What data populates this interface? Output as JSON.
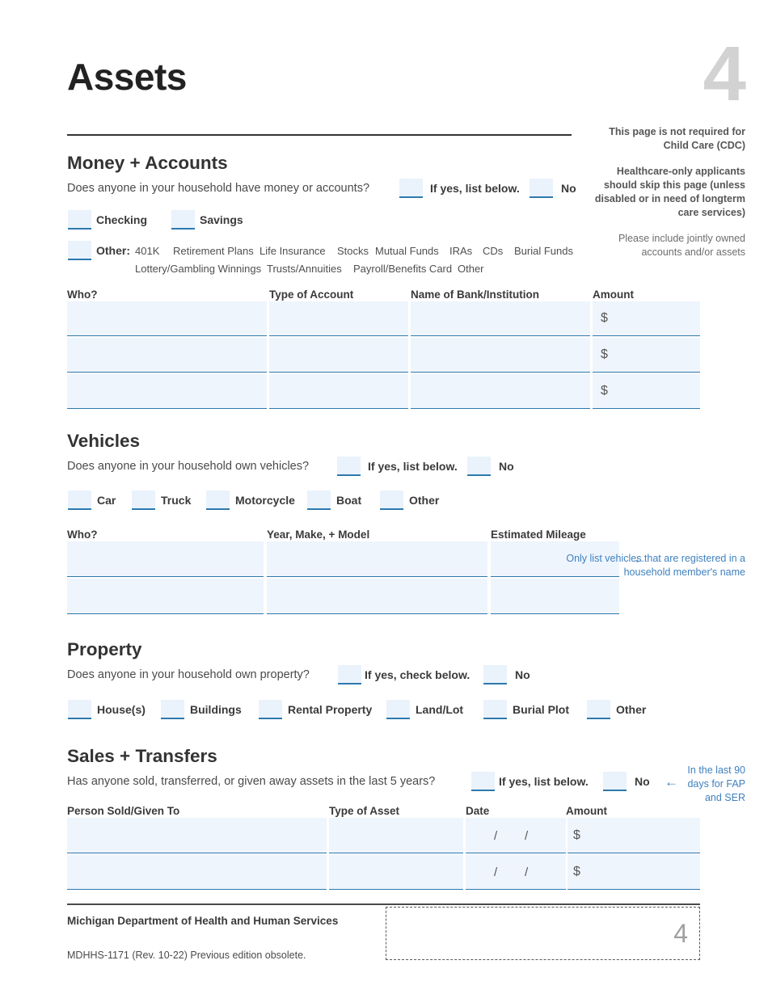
{
  "header": {
    "title": "Assets",
    "page_number": "4"
  },
  "right_notes": {
    "bold_note_1": "This page is not required for Child Care (CDC)",
    "bold_note_2": "Healthcare-only applicants should skip this page (unless disabled or in need of longterm care services)",
    "regular_note": "Please include jointly owned accounts and/or assets"
  },
  "money_accounts": {
    "heading": "Money + Accounts",
    "question": "Does anyone in your household have money or accounts?",
    "yes_label": "If yes, list below.",
    "no_label": "No",
    "type_checkboxes": [
      {
        "label": "Checking"
      },
      {
        "label": "Savings"
      }
    ],
    "other_label": "Other:",
    "other_options_row1": [
      "401K",
      "Retirement Plans",
      "Life Insurance",
      "Stocks",
      "Mutual Funds",
      "IRAs",
      "CDs",
      "Burial Funds"
    ],
    "other_options_row2": [
      "Lottery/Gambling Winnings",
      "Trusts/Annuities",
      "Payroll/Benefits Card",
      "Other"
    ],
    "table": {
      "columns": [
        "Who?",
        "Type of Account",
        "Name of Bank/Institution",
        "Amount"
      ],
      "amount_prefix": "$",
      "row_count": 3,
      "rows": [
        {
          "who": "",
          "type_of_account": "",
          "bank": "",
          "amount": ""
        },
        {
          "who": "",
          "type_of_account": "",
          "bank": "",
          "amount": ""
        },
        {
          "who": "",
          "type_of_account": "",
          "bank": "",
          "amount": ""
        }
      ]
    }
  },
  "vehicles": {
    "heading": "Vehicles",
    "question": "Does anyone in your household own vehicles?",
    "yes_label": "If yes, list below.",
    "no_label": "No",
    "type_checkboxes": [
      {
        "label": "Car"
      },
      {
        "label": "Truck"
      },
      {
        "label": "Motorcycle"
      },
      {
        "label": "Boat"
      },
      {
        "label": "Other"
      }
    ],
    "table": {
      "columns": [
        "Who?",
        "Year, Make, + Model",
        "Estimated Mileage"
      ],
      "row_count": 2,
      "rows": [
        {
          "who": "",
          "year_make_model": "",
          "mileage": ""
        },
        {
          "who": "",
          "year_make_model": "",
          "mileage": ""
        }
      ]
    },
    "side_note": "Only list vehicles that are registered in a household member's name",
    "side_note_arrow": "←"
  },
  "property": {
    "heading": "Property",
    "question": "Does anyone in your household own property?",
    "yes_label": "If yes, check below.",
    "no_label": "No",
    "type_checkboxes": [
      {
        "label": "House(s)"
      },
      {
        "label": "Buildings"
      },
      {
        "label": "Rental Property"
      },
      {
        "label": "Land/Lot"
      },
      {
        "label": "Burial Plot"
      },
      {
        "label": "Other"
      }
    ]
  },
  "sales_transfers": {
    "heading": "Sales + Transfers",
    "question": "Has anyone sold, transferred, or given away assets in the last 5 years?",
    "yes_label": "If yes, list below.",
    "no_label": "No",
    "side_note": "In the last 90 days for FAP and SER",
    "side_note_arrow": "←",
    "table": {
      "columns": [
        "Person Sold/Given To",
        "Type of Asset",
        "Date",
        "Amount"
      ],
      "date_separator": "/",
      "amount_prefix": "$",
      "row_count": 2,
      "rows": [
        {
          "person": "",
          "type_of_asset": "",
          "date": "",
          "amount": ""
        },
        {
          "person": "",
          "type_of_asset": "",
          "date": "",
          "amount": ""
        }
      ]
    }
  },
  "footer": {
    "agency": "Michigan Department of Health and Human Services",
    "form_id": "MDHHS-1171 (Rev. 10-22) Previous edition obsolete.",
    "page_number": "4"
  },
  "colors": {
    "field_fill": "#eef5fd",
    "field_underline": "#2d79ad",
    "note_blue": "#3f80be",
    "big_number_gray": "#d2d2d2"
  }
}
